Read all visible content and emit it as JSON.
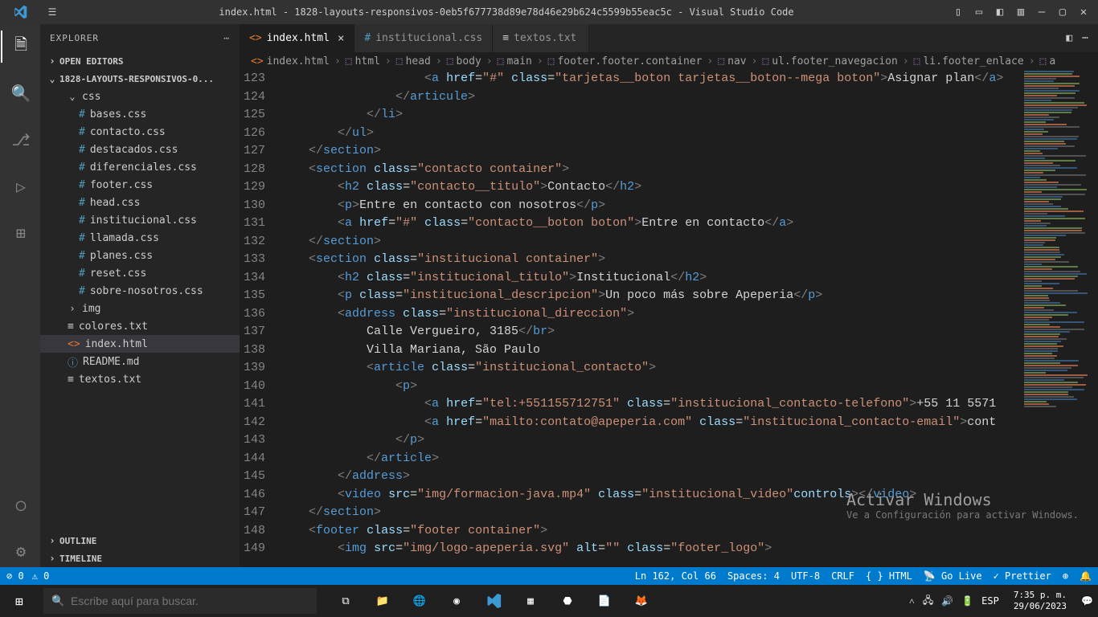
{
  "titlebar": {
    "title": "index.html - 1828-layouts-responsivos-0eb5f677738d89e78d46e29b624c5599b55eac5c - Visual Studio Code"
  },
  "sidebar": {
    "title": "EXPLORER",
    "open_editors": "OPEN EDITORS",
    "project": "1828-LAYOUTS-RESPONSIVOS-0...",
    "folder_css": "css",
    "files_css": [
      "bases.css",
      "contacto.css",
      "destacados.css",
      "diferenciales.css",
      "footer.css",
      "head.css",
      "institucional.css",
      "llamada.css",
      "planes.css",
      "reset.css",
      "sobre-nosotros.css"
    ],
    "folder_img": "img",
    "root_files": [
      {
        "name": "colores.txt",
        "icon": "txt"
      },
      {
        "name": "index.html",
        "icon": "html",
        "selected": true
      },
      {
        "name": "README.md",
        "icon": "info"
      },
      {
        "name": "textos.txt",
        "icon": "txt"
      }
    ],
    "outline": "OUTLINE",
    "timeline": "TIMELINE"
  },
  "tabs": [
    {
      "label": "index.html",
      "icon": "html",
      "active": true,
      "close": true
    },
    {
      "label": "institucional.css",
      "icon": "css",
      "active": false
    },
    {
      "label": "textos.txt",
      "icon": "txt",
      "active": false
    }
  ],
  "breadcrumb": [
    "index.html",
    "html",
    "head",
    "body",
    "main",
    "footer.footer.container",
    "nav",
    "ul.footer_navegacion",
    "li.footer_enlace",
    "a"
  ],
  "code_start_line": 123,
  "code_lines": [
    "                    <a href=\"#\" class=\"tarjetas__boton tarjetas__boton--mega boton\">Asignar plan</a>",
    "                </articule>",
    "            </li>",
    "        </ul>",
    "    </section>",
    "    <section class=\"contacto container\">",
    "        <h2 class=\"contacto__titulo\">Contacto</h2>",
    "        <p>Entre en contacto con nosotros</p>",
    "        <a href=\"#\" class=\"contacto__boton boton\">Entre en contacto</a>",
    "    </section>",
    "    <section class=\"institucional container\">",
    "        <h2 class=\"institucional_titulo\">Institucional</h2>",
    "        <p class=\"institucional_descripcion\">Un poco más sobre Apeperia</p>",
    "        <address class=\"institucional_direccion\">",
    "            Calle Vergueiro, 3185</br>",
    "            Villa Mariana, São Paulo",
    "            <article class=\"institucional_contacto\">",
    "                <p>",
    "                    <a href=\"tel:+551155712751\" class=\"institucional_contacto-telefono\">+55 11 5571",
    "                    <a href=\"mailto:contato@apeperia.com\" class=\"institucional_contacto-email\">cont",
    "                </p>",
    "            </article>",
    "        </address>",
    "        <video src=\"img/formacion-java.mp4\" class=\"institucional_video\"controls></video>",
    "    </section>",
    "    <footer class=\"footer container\">",
    "        <img src=\"img/logo-apeperia.svg\" alt=\"\" class=\"footer_logo\">"
  ],
  "statusbar": {
    "errors": "0",
    "warnings": "0",
    "position": "Ln 162, Col 66",
    "spaces": "Spaces: 4",
    "encoding": "UTF-8",
    "eol": "CRLF",
    "language": "HTML",
    "golive": "Go Live",
    "prettier": "Prettier"
  },
  "watermark": {
    "title": "Activar Windows",
    "sub": "Ve a Configuración para activar Windows."
  },
  "taskbar": {
    "search_placeholder": "Escribe aquí para buscar.",
    "lang": "ESP",
    "time": "7:35 p. m.",
    "date": "29/06/2023"
  }
}
